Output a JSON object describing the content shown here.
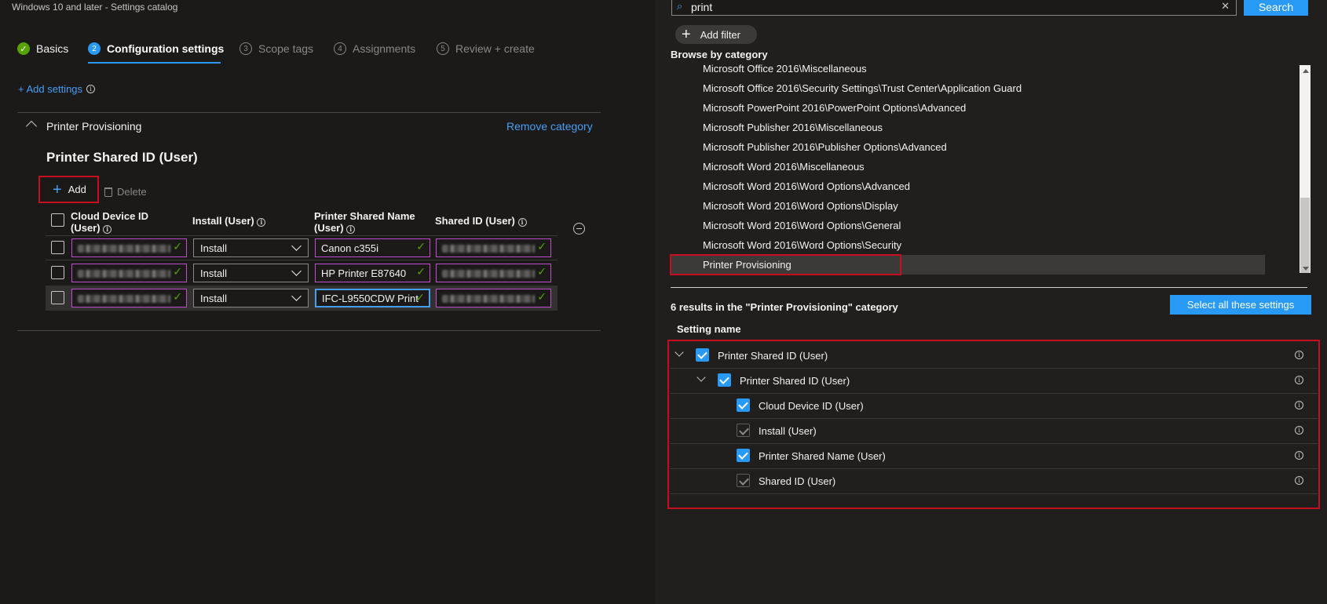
{
  "left": {
    "subtitle": "Windows 10 and later - Settings catalog",
    "steps": [
      {
        "num": "✓",
        "label": "Basics",
        "state": "done"
      },
      {
        "num": "2",
        "label": "Configuration settings",
        "state": "active"
      },
      {
        "num": "3",
        "label": "Scope tags",
        "state": "inactive"
      },
      {
        "num": "4",
        "label": "Assignments",
        "state": "inactive"
      },
      {
        "num": "5",
        "label": "Review + create",
        "state": "inactive"
      }
    ],
    "add_settings_label": "+ Add settings",
    "category_title": "Printer Provisioning",
    "remove_category_label": "Remove category",
    "setting_heading": "Printer Shared ID (User)",
    "add_label": "Add",
    "delete_label": "Delete",
    "table": {
      "headers": {
        "cloud_device_id_1": "Cloud Device ID",
        "cloud_device_id_2": "(User)",
        "install": "Install (User)",
        "printer_shared_name_1": "Printer Shared Name",
        "printer_shared_name_2": "(User)",
        "shared_id": "Shared ID (User)"
      },
      "rows": [
        {
          "install": "Install",
          "printer_name": "Canon c355i"
        },
        {
          "install": "Install",
          "printer_name": "HP Printer E87640"
        },
        {
          "install": "Install",
          "printer_name": "IFC-L9550CDW Print"
        }
      ]
    }
  },
  "right": {
    "search_value": "print",
    "search_button": "Search",
    "add_filter": "Add filter",
    "browse_heading": "Browse by category",
    "categories": [
      "Microsoft Office 2016\\Miscellaneous",
      "Microsoft Office 2016\\Security Settings\\Trust Center\\Application Guard",
      "Microsoft PowerPoint 2016\\PowerPoint Options\\Advanced",
      "Microsoft Publisher 2016\\Miscellaneous",
      "Microsoft Publisher 2016\\Publisher Options\\Advanced",
      "Microsoft Word 2016\\Miscellaneous",
      "Microsoft Word 2016\\Word Options\\Advanced",
      "Microsoft Word 2016\\Word Options\\Display",
      "Microsoft Word 2016\\Word Options\\General",
      "Microsoft Word 2016\\Word Options\\Security",
      "Printer Provisioning"
    ],
    "results_heading": "6 results in the \"Printer Provisioning\" category",
    "select_all_label": "Select all these settings",
    "column_heading": "Setting name",
    "settings": [
      {
        "label": "Printer Shared ID (User)",
        "checked": true,
        "disabled": false
      },
      {
        "label": "Printer Shared ID (User)",
        "checked": true,
        "disabled": false
      },
      {
        "label": "Cloud Device ID (User)",
        "checked": true,
        "disabled": false
      },
      {
        "label": "Install (User)",
        "checked": true,
        "disabled": true
      },
      {
        "label": "Printer Shared Name (User)",
        "checked": true,
        "disabled": false
      },
      {
        "label": "Shared ID (User)",
        "checked": true,
        "disabled": true
      }
    ]
  },
  "colors": {
    "accent": "#2899f5",
    "link": "#479ef5",
    "highlight_border": "#c50f1f",
    "success": "#57a300",
    "valid_border": "#c44bd4"
  },
  "icons": [
    "check-circle-icon",
    "info-icon",
    "chevron-up-icon",
    "plus-icon",
    "trash-icon",
    "chevron-down-icon",
    "checkmark-icon",
    "remove-circle-icon",
    "search-icon",
    "clear-icon",
    "scroll-up-icon",
    "scroll-down-icon"
  ]
}
